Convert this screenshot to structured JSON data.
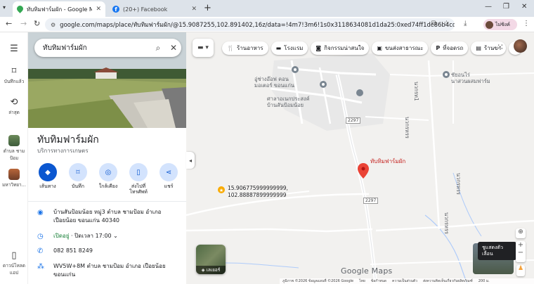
{
  "browser": {
    "tabs": [
      {
        "title": "ทับทิมฟาร์มผัก - Google Maps",
        "active": true
      },
      {
        "title": "(20+) Facebook",
        "active": false
      }
    ],
    "new_tab": "+",
    "url": "google.com/maps/place/ทับทิมฟาร์มผัก/@15.9087255,102.891402,16z/data=!4m7!3m6!1s0x3118634081d1da25:0xed74ff1dc86b4cd2!8m2!3d15.90...",
    "profile_label": "ไม่ซิงค์"
  },
  "rail": {
    "menu_icon": "menu-icon",
    "items": [
      {
        "label": "บันทึกแล้ว",
        "icon": "bookmark-icon"
      },
      {
        "label": "ล่าสุด",
        "icon": "history-icon"
      },
      {
        "label": "ตำบล ชาม ป้อม",
        "icon": "thumb"
      },
      {
        "label": "มหาวิทยา...",
        "icon": "thumb"
      },
      {
        "label": "ดาวน์โหลดแอป",
        "icon": "phone-icon"
      }
    ]
  },
  "search": {
    "value": "ทับทิมฟาร์มผัก"
  },
  "place": {
    "title": "ทับทิมฟาร์มผัก",
    "category": "บริการทางการเกษตร",
    "actions": [
      {
        "label": "เส้นทาง",
        "icon": "directions-icon"
      },
      {
        "label": "บันทึก",
        "icon": "bookmark-icon"
      },
      {
        "label": "ใกล้เคียง",
        "icon": "nearby-icon"
      },
      {
        "label": "ส่งไปที่โทรศัพท์",
        "icon": "send-to-phone-icon"
      },
      {
        "label": "แชร์",
        "icon": "share-icon"
      }
    ],
    "address": "บ้านสันป้อมน้อย หมู่3 ตำบล ชามป้อม อำเภอ เปือยน้อย ขอนแก่น 40340",
    "hours_status": "เปิดอยู่",
    "hours_close": " · ปิดเวลา 17:00",
    "phone": "082 851 8249",
    "plus_code": "WV5W+8M ตำบล ชามป้อม อำเภอ เปือยน้อย ขอนแก่น"
  },
  "map": {
    "chips": [
      {
        "label": "ร้านอาหาร",
        "icon": "restaurant-icon"
      },
      {
        "label": "โรงแรม",
        "icon": "hotel-icon"
      },
      {
        "label": "กิจกรรมน่าสนใจ",
        "icon": "camera-icon"
      },
      {
        "label": "ขนส่งสาธารณะ",
        "icon": "transit-icon"
      },
      {
        "label": "ที่จอดรถ",
        "icon": "parking-icon"
      },
      {
        "label": "ร้านขา",
        "icon": "shop-icon"
      }
    ],
    "labels": {
      "poi1": "อู่ช่างอ๊อฟ คอน\nมอเตอร์ ขอนแก่น",
      "poi2": "ศาลาอเนกประสงค์\nบ้านสันป้อมน้อย",
      "poi3": "ชัยอนไร่\nนาสวนผสมฟาร์ม",
      "pin": "ทับทิมฟาร์มผัก",
      "coord": "15.906775999999999,\n102.88887899999999",
      "road_right": "นวกรท1",
      "road_right2": "นวกรหรร",
      "road_mid": "นวกรหรร",
      "road_low": "นวกรหรร"
    },
    "route_numbers": [
      "2297",
      "2297"
    ],
    "layers_label": "เลเยอร์",
    "streetview_tooltip": "ชูแสดงตัวเลื่อน",
    "brand": "Google Maps",
    "footer": [
      "ภูมิภาพ ©2026 ข้อมูลแผนที่ ©2026 Google",
      "ไทย",
      "ข้อกำหนด",
      "ความเป็นส่วนตัว",
      "ส่งความคิดเห็นเกี่ยวกับผลิตภัณฑ์",
      "200 ม."
    ]
  },
  "colors": {
    "accent": "#0b57d0",
    "pin": "#ea4335",
    "open": "#188038"
  }
}
